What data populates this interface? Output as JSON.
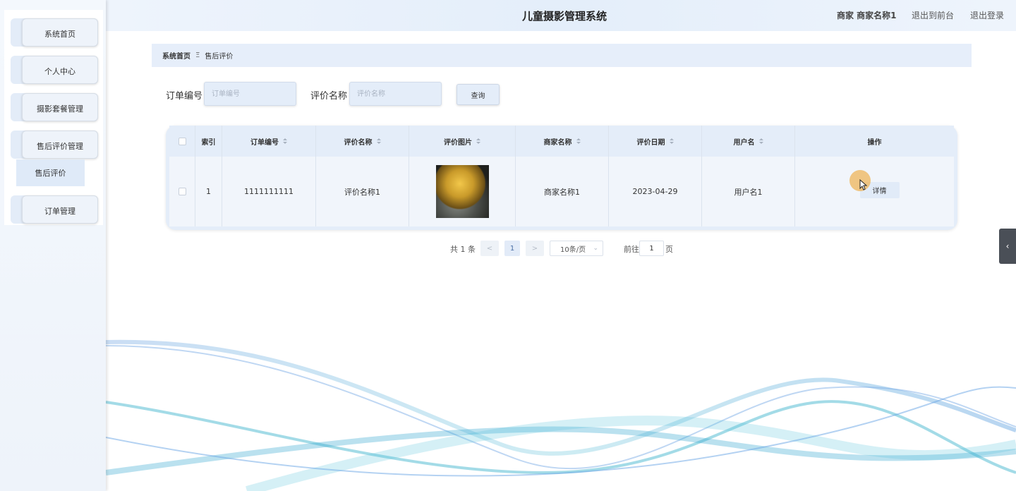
{
  "app": {
    "title": "儿童摄影管理系统",
    "user_label": "商家 商家名称1",
    "back_to_front": "退出到前台",
    "logout": "退出登录"
  },
  "sidebar": {
    "items": [
      {
        "label": "系统首页"
      },
      {
        "label": "个人中心"
      },
      {
        "label": "摄影套餐管理"
      },
      {
        "label": "售后评价管理"
      },
      {
        "label": "订单管理"
      }
    ],
    "submenu": {
      "label": "售后评价"
    }
  },
  "breadcrumb": {
    "home": "系统首页",
    "sep": "Ξ",
    "current": "售后评价"
  },
  "search": {
    "order_label": "订单编号",
    "order_placeholder": "订单编号",
    "review_label": "评价名称",
    "review_placeholder": "评价名称",
    "query_button": "查询"
  },
  "table": {
    "columns": [
      "索引",
      "订单编号",
      "评价名称",
      "评价图片",
      "商家名称",
      "评价日期",
      "用户名",
      "操作"
    ],
    "rows": [
      {
        "index": "1",
        "order_no": "1111111111",
        "review_name": "评价名称1",
        "merchant": "商家名称1",
        "date": "2023-04-29",
        "username": "用户名1",
        "action": "详情"
      }
    ]
  },
  "pagination": {
    "total": "共 1 条",
    "prev": "<",
    "page": "1",
    "next": ">",
    "page_size": "10条/页",
    "goto_prefix": "前往",
    "goto_value": "1",
    "goto_suffix": "页"
  },
  "side_toggle": {
    "label": "‹"
  },
  "colors": {
    "accent": "#e4edf9",
    "header_bg": "#e4eefa",
    "toggle_bg": "#4a4f57"
  }
}
